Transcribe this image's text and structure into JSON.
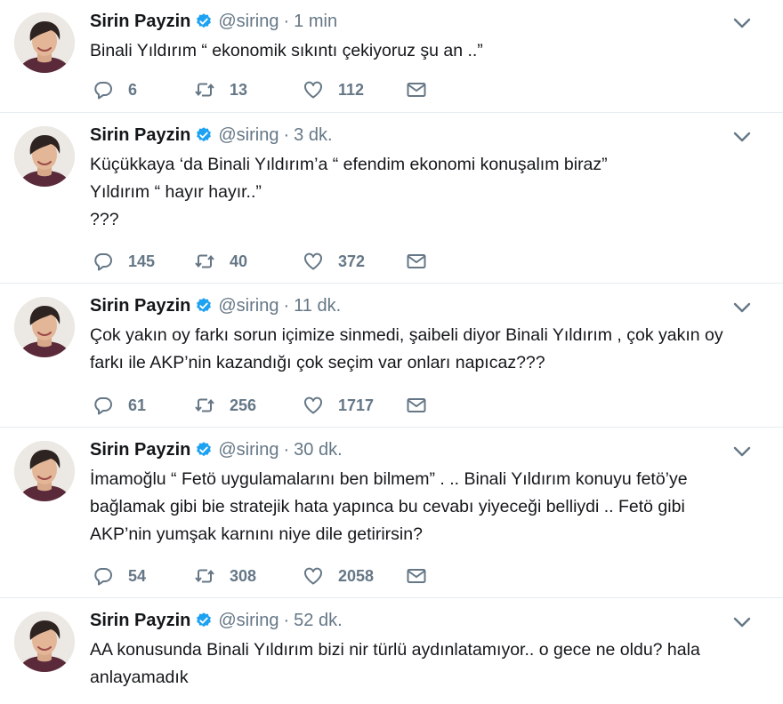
{
  "tweets": [
    {
      "name": "Sirin Payzin",
      "handle": "@siring",
      "time": "1 min",
      "lines": [
        "Binali Yıldırım “ ekonomik sıkıntı çekiyoruz şu an ..”"
      ],
      "replies": "6",
      "retweets": "13",
      "likes": "112"
    },
    {
      "name": "Sirin Payzin",
      "handle": "@siring",
      "time": "3 dk.",
      "lines": [
        "Küçükkaya ‘da Binali Yıldırım’a “ efendim ekonomi konuşalım biraz”",
        "Yıldırım “ hayır hayır..”",
        "???"
      ],
      "replies": "145",
      "retweets": "40",
      "likes": "372"
    },
    {
      "name": "Sirin Payzin",
      "handle": "@siring",
      "time": "11 dk.",
      "lines": [
        "Çok yakın oy farkı sorun içimize  sinmedi, şaibeli  diyor Binali Yıldırım  , çok yakın oy",
        "farkı ile AKP’nin kazandığı  çok seçim var  onları napıcaz???"
      ],
      "replies": "61",
      "retweets": "256",
      "likes": "1717"
    },
    {
      "name": "Sirin Payzin",
      "handle": "@siring",
      "time": "30 dk.",
      "lines": [
        "İmamoğlu “ Fetö uygulamalarını ben bilmem” . .. Binali Yıldırım konuyu fetö’ye",
        "bağlamak gibi bie stratejik hata yapınca bu cevabı yiyeceği belliydi .. Fetö gibi",
        "AKP’nin yumşak karnını niye dile getirirsin?"
      ],
      "replies": "54",
      "retweets": "308",
      "likes": "2058"
    },
    {
      "name": "Sirin Payzin",
      "handle": "@siring",
      "time": "52 dk.",
      "lines": [
        "AA konusunda Binali Yıldırım  bizi nir türlü aydınlatamıyor.. o gece ne oldu? hala",
        "anlayamadık"
      ],
      "replies": "",
      "retweets": "",
      "likes": ""
    }
  ],
  "icons": {
    "reply": "reply-icon",
    "retweet": "retweet-icon",
    "like": "heart-icon",
    "message": "envelope-icon",
    "verified": "verified-badge-icon",
    "menu": "chevron-down-icon"
  },
  "colors": {
    "name": "#14171a",
    "meta": "#657786",
    "verified": "#1da1f2",
    "divider": "#e6ecf0"
  }
}
